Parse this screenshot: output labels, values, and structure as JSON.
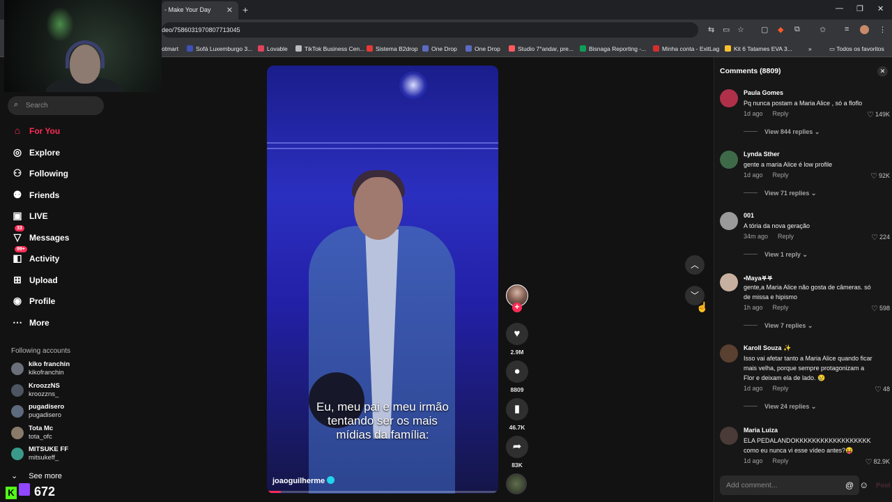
{
  "browser": {
    "tab_title": "- Make Your Day",
    "url": "deo/7586031970807713045",
    "bookmarks": [
      {
        "label": "otmart",
        "color": "#ff5a26"
      },
      {
        "label": "Sofá Luxemburgo 3...",
        "color": "#3f51b5"
      },
      {
        "label": "Lovable",
        "color": "#e2425b"
      },
      {
        "label": "TikTok Business Cen...",
        "color": "#bbbbbb"
      },
      {
        "label": "Sistema B2drop",
        "color": "#e53935"
      },
      {
        "label": "One Drop",
        "color": "#5c6bc0"
      },
      {
        "label": "One Drop",
        "color": "#5c6bc0"
      },
      {
        "label": "Studio 7°andar, pre...",
        "color": "#ff5a5f"
      },
      {
        "label": "Bisnaga Reporting -...",
        "color": "#0f9d58"
      },
      {
        "label": "Minha conta - ExitLag",
        "color": "#d32f2f"
      },
      {
        "label": "Kit 6 Tatames EVA 3...",
        "color": "#fbc02d"
      }
    ],
    "all_bookmarks": "Todos os favoritos"
  },
  "sidebar": {
    "search_placeholder": "Search",
    "nav": [
      {
        "label": "For You",
        "icon": "home-icon",
        "active": true
      },
      {
        "label": "Explore",
        "icon": "compass-icon"
      },
      {
        "label": "Following",
        "icon": "following-icon"
      },
      {
        "label": "Friends",
        "icon": "friends-icon"
      },
      {
        "label": "LIVE",
        "icon": "live-icon"
      },
      {
        "label": "Messages",
        "icon": "messages-icon",
        "badge": "33"
      },
      {
        "label": "Activity",
        "icon": "activity-icon",
        "badge": "99+"
      },
      {
        "label": "Upload",
        "icon": "upload-icon"
      },
      {
        "label": "Profile",
        "icon": "profile-icon"
      },
      {
        "label": "More",
        "icon": "more-icon"
      }
    ],
    "following_title": "Following accounts",
    "accounts": [
      {
        "name": "kiko franchin",
        "handle": "kikofranchin",
        "color": "#6b6f7a"
      },
      {
        "name": "KroozzNS",
        "handle": "kroozzns_",
        "color": "#4c5560"
      },
      {
        "name": "pugadisero",
        "handle": "pugadisero",
        "color": "#5e6a7d"
      },
      {
        "name": "Tota Mc",
        "handle": "tota_ofc",
        "color": "#8a7a6a"
      },
      {
        "name": "MITSUKE FF",
        "handle": "mitsukeff_",
        "color": "#3a9a8a"
      }
    ],
    "see_more": "See more",
    "kick_count": "672"
  },
  "video": {
    "caption": "Eu, meu pai e meu irmão\ntentando ser os mais\nmídias da família:",
    "author": "joaoguilherme",
    "progress": 0.06
  },
  "actions": {
    "likes": "2.9M",
    "comments": "8809",
    "saves": "46.7K",
    "shares": "83K"
  },
  "comments": {
    "title": "Comments (8809)",
    "reply_label": "Reply",
    "items": [
      {
        "user": "Paula Gomes",
        "text": "Pq nunca postam a Maria Alice , só a floflo",
        "time": "1d ago",
        "likes": "149K",
        "replies": "View 844 replies",
        "color": "#b0304a"
      },
      {
        "user": "Lynda Sther",
        "text": "gente a maria Alice é low profile",
        "time": "1d ago",
        "likes": "92K",
        "replies": "View 71 replies",
        "color": "#3f6a4a"
      },
      {
        "user": "001",
        "text": "A tória da nova geração",
        "time": "34m ago",
        "likes": "224",
        "replies": "View 1 reply",
        "color": "#9a9a9a"
      },
      {
        "user": "•Maya𖤐𖤐",
        "text": "gente,a Maria Alice não gosta de câmeras. só de missa e hipismo",
        "time": "1h ago",
        "likes": "598",
        "replies": "View 7 replies",
        "color": "#c8b0a0"
      },
      {
        "user": "Karoll Souza ✨",
        "text": "Isso vai afetar tanto a Maria Alice quando ficar mais velha, porque sempre protagonizam a Flor e deixam ela de lado. 😢",
        "time": "1d ago",
        "likes": "48",
        "replies": "View 24 replies",
        "color": "#5a4030"
      },
      {
        "user": "Maria Luiza",
        "text": "ELA PEDALANDOKKKKKKKKKKKKKKKKKK como eu nunca vi esse vídeo antes?😝",
        "time": "1d ago",
        "likes": "82.9K",
        "replies": "",
        "color": "#4a3a38"
      }
    ],
    "input_placeholder": "Add comment...",
    "post_label": "Post"
  }
}
